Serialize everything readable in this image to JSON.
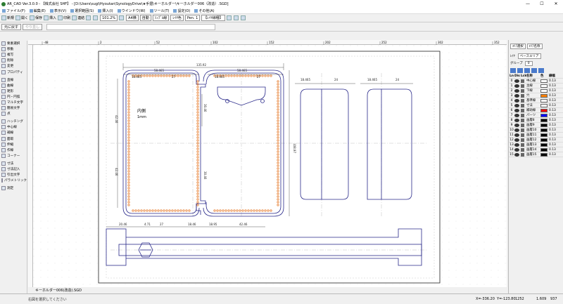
{
  "window": {
    "title": "AR_CAD Ver.3.0.0 - 【株式会社 SHF】 - [D:\\Users\\sugi\\Hyoutan\\SynologyDrive\\★手摺\\キーホルダー\\キーホルダー006（改造）.SGD]",
    "minimize": "—",
    "maximize": "☐",
    "close": "✕"
  },
  "menubar": {
    "items": [
      {
        "label": "ファイル(F)"
      },
      {
        "label": "編集(E)"
      },
      {
        "label": "表示(V)"
      },
      {
        "label": "選択範囲(S)"
      },
      {
        "label": "挿入(I)"
      },
      {
        "label": "ウインドウ(W)"
      },
      {
        "label": "ツール(T)"
      },
      {
        "label": "設定(O)"
      },
      {
        "label": "その他(A)"
      }
    ]
  },
  "toolbar": {
    "new": "新規",
    "open": "開く",
    "save": "保存",
    "insert": "挿入",
    "print": "印刷",
    "preview": "連結",
    "zoom": "101.2%",
    "paper": "A4横",
    "auto": "自動",
    "line_width": "ｼﾝﾌﾟﾙ線",
    "line_color": "ﾚｲﾔ色",
    "pen": "Pen. 1",
    "line_type": "【ﾚｲﾔ線種】"
  },
  "subbar": {
    "undo": "元に戻す",
    "redo": "やり直し"
  },
  "tools": [
    {
      "label": "要素選択"
    },
    {
      "label": "移動"
    },
    {
      "label": "複写"
    },
    {
      "label": "削除"
    },
    {
      "label": "変更"
    },
    {
      "label": "プロパティ"
    },
    {
      "label": "直線"
    },
    {
      "label": "曲線"
    },
    {
      "label": "矩形"
    },
    {
      "label": "円・円弧"
    },
    {
      "label": "マルチ文字"
    },
    {
      "label": "簡易文字"
    },
    {
      "label": "点"
    },
    {
      "label": "ハッチング"
    },
    {
      "label": "中心線"
    },
    {
      "label": "補線"
    },
    {
      "label": "面取"
    },
    {
      "label": "伸縮"
    },
    {
      "label": "作線"
    },
    {
      "label": "コーナー"
    },
    {
      "label": "寸法"
    },
    {
      "label": "寸法記入"
    },
    {
      "label": "引出文字"
    },
    {
      "label": "パラメトリック"
    },
    {
      "label": "測定"
    }
  ],
  "ruler": {
    "top_ticks": [
      "-48",
      "2",
      "52",
      "102",
      "152",
      "202",
      "252",
      "302",
      "352"
    ]
  },
  "drawing": {
    "dims": {
      "overall_width": "135.92",
      "half_left": "58.465",
      "half_right": "58.465",
      "inner_a": "18.465",
      "inner_b": "27",
      "inner_c": "18.465",
      "inner_d": "27",
      "height_total": "108.97",
      "h_upper": "30.46",
      "h_lower": "30.46",
      "v_left_top": "42.46",
      "v_left_bottom": "42.46",
      "side_a": "18.465",
      "side_b": "24",
      "side_c": "18.465",
      "side_d": "24",
      "bottom_a": "20.46",
      "bottom_b": "4.71",
      "bottom_c": "27",
      "bottom_d": "18.46",
      "bottom_e": "18.95",
      "bottom_f": "42.46"
    },
    "note_line1": "内側",
    "note_line2": "1mm"
  },
  "tab": {
    "label": "キーホルダー006(改造).SGD"
  },
  "status": {
    "hint": "右図を選択してください",
    "x": "X=-336.20",
    "y": "Y=-123.80",
    "val1": "1252",
    "val2": "1.609",
    "val3": "937"
  },
  "right_panel": {
    "tabs": [
      "ｴﾘｱ選択",
      "ｴﾘｱ名称"
    ],
    "layer_label": "ﾚｲﾔ",
    "base_area": "ベースエリア",
    "group_label": "グループ",
    "group_value": "0",
    "col_headers": [
      "Ln",
      "Dis",
      "Lck",
      "名称",
      "色",
      "線幅"
    ],
    "layers": [
      {
        "num": "0",
        "name": "中心線",
        "color": "#ffffff",
        "w": "0.13"
      },
      {
        "num": "1",
        "name": "主線",
        "color": "#ffffff",
        "w": "0.13"
      },
      {
        "num": "2",
        "name": "下線",
        "color": "#ffffff",
        "w": "0.13"
      },
      {
        "num": "3",
        "name": "穴",
        "color": "#ff8000",
        "w": "0.13"
      },
      {
        "num": "4",
        "name": "基準線",
        "color": "#ffffff",
        "w": "0.13"
      },
      {
        "num": "5",
        "name": "寸法",
        "color": "#ffffff",
        "w": "0.13"
      },
      {
        "num": "6",
        "name": "補助線",
        "color": "#ff0000",
        "w": "0.13"
      },
      {
        "num": "7",
        "name": "パーツ",
        "color": "#0000ff",
        "w": "0.13"
      },
      {
        "num": "8",
        "name": "画層8",
        "color": "#000000",
        "w": "0.13"
      },
      {
        "num": "9",
        "name": "画層9",
        "color": "#000000",
        "w": "0.13"
      },
      {
        "num": "10",
        "name": "画層10",
        "color": "#000000",
        "w": "0.13"
      },
      {
        "num": "11",
        "name": "画層11",
        "color": "#000000",
        "w": "0.13"
      },
      {
        "num": "12",
        "name": "画層12",
        "color": "#000000",
        "w": "0.13"
      },
      {
        "num": "13",
        "name": "画層13",
        "color": "#000000",
        "w": "0.13"
      },
      {
        "num": "14",
        "name": "画層14",
        "color": "#000000",
        "w": "0.13"
      },
      {
        "num": "15",
        "name": "画層15",
        "color": "#000000",
        "w": "0.13"
      }
    ]
  },
  "colors": {
    "outline": "#2a2a8a",
    "holes": "#e8843a",
    "dim": "#333333"
  }
}
